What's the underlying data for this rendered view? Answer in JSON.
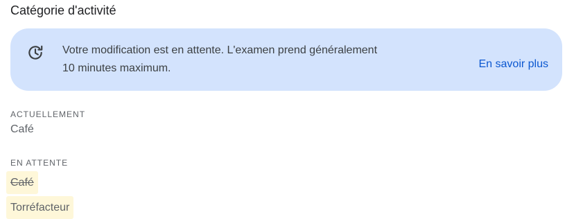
{
  "header": {
    "title": "Catégorie d'activité"
  },
  "banner": {
    "icon": "clock-pending-icon",
    "line1": "Votre modification est en attente. L'examen prend généralement",
    "line2": "10 minutes maximum.",
    "link_label": "En savoir plus",
    "background_color": "#d3e3fd",
    "link_color": "#0b57d0"
  },
  "current": {
    "label": "ACTUELLEMENT",
    "value": "Café"
  },
  "pending": {
    "label": "EN ATTENTE",
    "removed_value": "Café",
    "added_value": "Torréfacteur",
    "highlight_color": "#fef7d9"
  }
}
